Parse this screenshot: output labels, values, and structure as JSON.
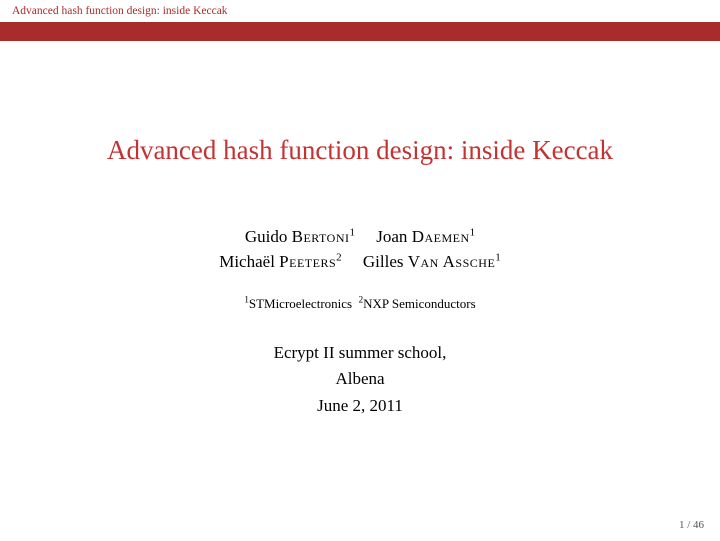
{
  "header": {
    "label": "Advanced hash function design: inside Keccak"
  },
  "title": "Advanced hash function design: inside Keccak",
  "authors": {
    "a1_first": "Guido",
    "a1_last": "Bertoni",
    "a1_aff": "1",
    "a2_first": "Joan",
    "a2_last": "Daemen",
    "a2_aff": "1",
    "a3_first": "Michaël",
    "a3_last": "Peeters",
    "a3_aff": "2",
    "a4_first": "Gilles",
    "a4_last": "Van Assche",
    "a4_aff": "1"
  },
  "affiliations": {
    "n1": "1",
    "t1": "STMicroelectronics",
    "n2": "2",
    "t2": "NXP Semiconductors"
  },
  "venue": {
    "line1": "Ecrypt II summer school,",
    "line2": "Albena",
    "line3": "June 2, 2011"
  },
  "page": {
    "current": "1",
    "sep": " / ",
    "total": "46"
  }
}
